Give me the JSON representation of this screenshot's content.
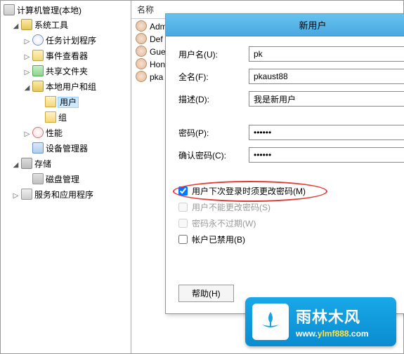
{
  "tree": {
    "root": "计算机管理(本地)",
    "system_tools": "系统工具",
    "task_scheduler": "任务计划程序",
    "event_viewer": "事件查看器",
    "shared_folders": "共享文件夹",
    "local_users_groups": "本地用户和组",
    "users": "用户",
    "groups": "组",
    "performance": "性能",
    "device_manager": "设备管理器",
    "storage": "存储",
    "disk_management": "磁盘管理",
    "services_apps": "服务和应用程序"
  },
  "list": {
    "header_name": "名称",
    "items": [
      "Admi",
      "Def",
      "Gue",
      "Hon",
      "pka"
    ]
  },
  "dialog": {
    "title": "新用户",
    "username_label": "用户名(U):",
    "username_value": "pk",
    "fullname_label": "全名(F):",
    "fullname_value": "pkaust88",
    "description_label": "描述(D):",
    "description_value": "我是新用户",
    "password_label": "密码(P):",
    "password_value": "••••••",
    "confirm_label": "确认密码(C):",
    "confirm_value": "••••••",
    "chk_must_change": "用户下次登录时须更改密码(M)",
    "chk_cannot_change": "用户不能更改密码(S)",
    "chk_never_expire": "密码永不过期(W)",
    "chk_disabled": "帐户已禁用(B)",
    "help_btn": "帮助(H)"
  },
  "logo": {
    "brand": "雨林木风",
    "url_pre": "www.",
    "url_mid": "ylmf888",
    "url_post": ".com"
  }
}
